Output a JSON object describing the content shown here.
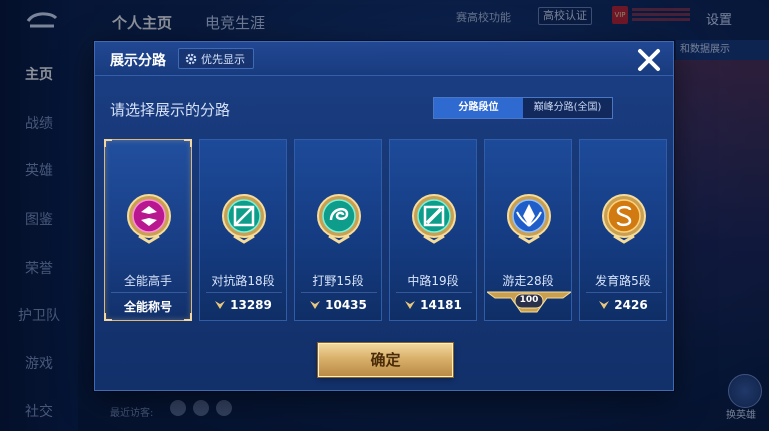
{
  "nav": {
    "items": [
      "主页",
      "战绩",
      "英雄",
      "图鉴",
      "荣誉",
      "护卫队",
      "游戏",
      "社交"
    ],
    "active_index": 0
  },
  "top": {
    "tabs": [
      "个人主页",
      "电竞生涯"
    ],
    "campus_fn": "赛高校功能",
    "campus_badge": "高校认证",
    "settings": "设置",
    "data_btn": "和数据展示"
  },
  "footer": {
    "visitors": "最近访客:",
    "cta_label": "换英雄"
  },
  "modal": {
    "title": "展示分路",
    "priority_label": "优先显示",
    "prompt": "请选择展示的分路",
    "toggle": {
      "options": [
        "分路段位",
        "巅峰分路(全国)"
      ],
      "active_index": 0
    },
    "confirm": "确定",
    "icons": {
      "priority": "gear-icon",
      "close": "close-icon",
      "power": "power-icon"
    }
  },
  "cards": [
    {
      "label": "全能高手",
      "footer": "全能称号",
      "icon": "all-round-badge-icon",
      "selected": true
    },
    {
      "label": "对抗路18段",
      "footer": "13289",
      "icon": "clash-lane-badge-icon",
      "selected": false
    },
    {
      "label": "打野15段",
      "footer": "10435",
      "icon": "jungle-badge-icon",
      "selected": false
    },
    {
      "label": "中路19段",
      "footer": "14181",
      "icon": "mid-lane-badge-icon",
      "selected": false
    },
    {
      "label": "游走28段",
      "footer": "100",
      "icon": "roam-badge-icon",
      "selected": false
    },
    {
      "label": "发育路5段",
      "footer": "2426",
      "icon": "farm-lane-badge-icon",
      "selected": false
    }
  ],
  "colors": {
    "accent": "#2f6ad0",
    "gold": "#d9b06a",
    "modal_bg": "#173775"
  }
}
